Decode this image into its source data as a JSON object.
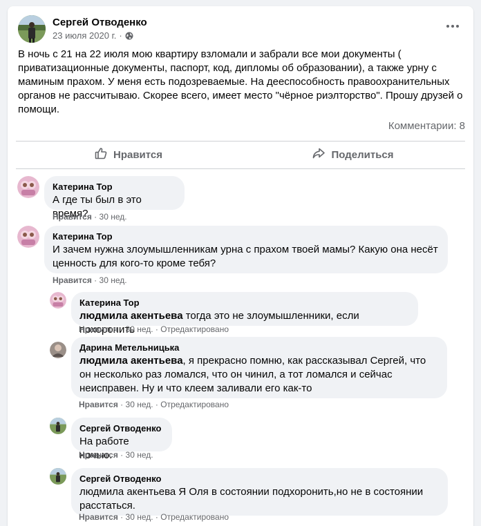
{
  "post": {
    "author": "Сергей Отводенко",
    "date": "23 июля 2020 г.",
    "separator": "·",
    "text": "В ночь с 21 на 22 июля мою квартиру взломали и забрали все мои документы ( приватизационные документы, паспорт, код, дипломы об образовании), а также урну с маминым прахом. У меня есть подозреваемые. На дееспособность правоохранительных органов не рассчитываю. Скорее всего, имеет место \"чёрное риэлторство\". Прошу друзей о помощи.",
    "comments_count": "Комментарии: 8",
    "like_label": "Нравится",
    "share_label": "Поделиться"
  },
  "comments": [
    {
      "name": "Катерина Тор",
      "text": "А где ты был в это время?",
      "like": "Нравится",
      "dot": "·",
      "time": "30 нед."
    },
    {
      "name": "Катерина Тор",
      "text": "И зачем нужна злоумышленникам урна с прахом твоей мамы? Какую она несёт ценность для кого-то кроме тебя?",
      "like": "Нравится",
      "dot": "·",
      "time": "30 нед."
    }
  ],
  "replies": [
    {
      "name": "Катерина Тор",
      "mention": "людмила акентьева",
      "text": " тогда это не злоумышленники, если похоронить",
      "like": "Нравится",
      "dot": "·",
      "time": "30 нед.",
      "edited": "Отредактировано"
    },
    {
      "name": "Дарина Метельницька",
      "mention": "людмила акентьева",
      "text": ", я прекрасно помню, как рассказывал Сергей, что он несколько раз ломался, что он чинил, а тот ломался и сейчас неисправен. Ну и что клеем заливали его как-то",
      "like": "Нравится",
      "dot": "·",
      "time": "30 нед.",
      "edited": "Отредактировано"
    },
    {
      "name": "Сергей Отводенко",
      "text": "На работе ночью.",
      "like": "Нравится",
      "dot": "·",
      "time": "30 нед."
    },
    {
      "name": "Сергей Отводенко",
      "text": "людмила акентьева Я Оля в состоянии подхоронить,но не в состоянии расстаться.",
      "like": "Нравится",
      "dot": "·",
      "time": "30 нед.",
      "edited": "Отредактировано"
    }
  ],
  "colors": {
    "background": "#f0f2f5",
    "card": "#ffffff",
    "secondary_text": "#65676b",
    "bubble": "#f0f2f5"
  }
}
